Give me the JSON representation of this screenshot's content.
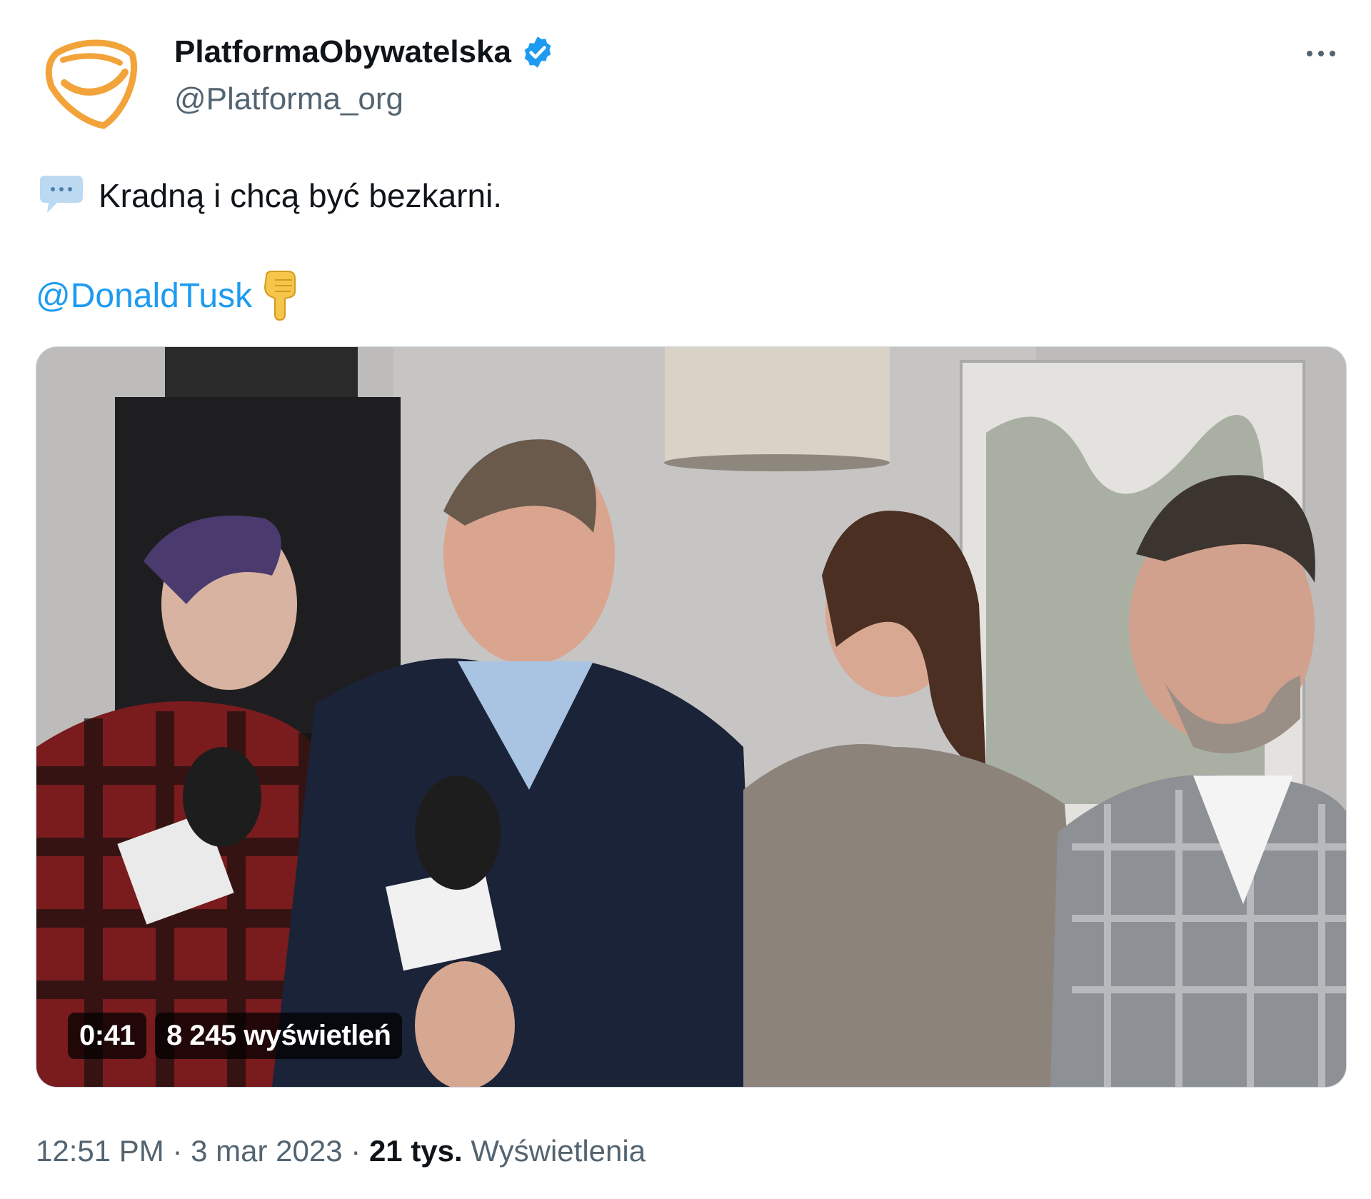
{
  "author": {
    "display_name": "PlatformaObywatelska",
    "handle": "@Platforma_org",
    "verified": true,
    "avatar_icon": "platforma-logo",
    "brand_color": "#f2a33a"
  },
  "tweet": {
    "text": "Kradną i chcą być bezkarni.",
    "leading_emoji": "speech-balloon-icon",
    "mention": "@DonaldTusk",
    "trailing_emoji": "backhand-index-pointing-down-icon"
  },
  "video": {
    "duration": "0:41",
    "views": "8 245 wyświetleń"
  },
  "footer": {
    "time": "12:51 PM",
    "separator": "·",
    "date": "3 mar 2023",
    "views_count": "21 tys.",
    "views_label": "Wyświetlenia"
  },
  "colors": {
    "link": "#1d9bf0",
    "secondary_text": "#536471",
    "primary_text": "#0f1419",
    "verified": "#1d9bf0"
  }
}
